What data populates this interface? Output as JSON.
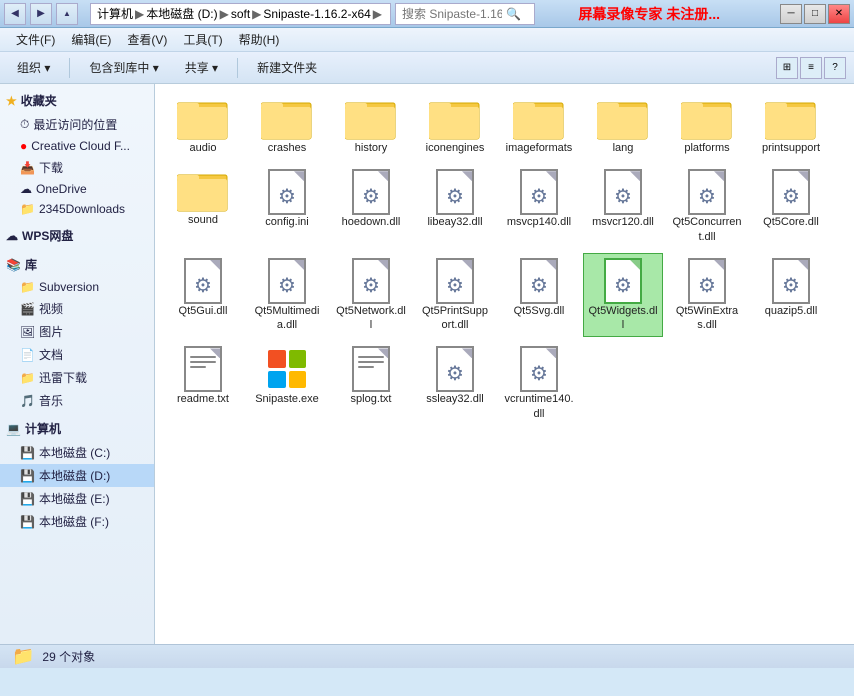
{
  "titleBar": {
    "pathParts": [
      "计算机",
      "本地磁盘 (D:)",
      "soft",
      "Snipaste-1.16.2-x64"
    ],
    "watermark": "屏幕录像专家 未注册...",
    "btns": [
      "min",
      "max",
      "close"
    ]
  },
  "menuBar": {
    "items": [
      "文件(F)",
      "编辑(E)",
      "查看(V)",
      "工具(T)",
      "帮助(H)"
    ]
  },
  "toolbar": {
    "organize": "组织 ▾",
    "include": "包含到库中 ▾",
    "share": "共享 ▾",
    "newFolder": "新建文件夹"
  },
  "sidebar": {
    "favorites": "收藏夹",
    "favoriteItems": [
      {
        "label": "最近访问的位置",
        "icon": "⏱"
      },
      {
        "label": "Creative Cloud F...",
        "icon": "🔴"
      },
      {
        "label": "下载",
        "icon": "📥"
      },
      {
        "label": "OneDrive",
        "icon": "☁"
      },
      {
        "label": "2345Downloads",
        "icon": "📁"
      }
    ],
    "wps": "WPS网盘",
    "library": "库",
    "libraryItems": [
      {
        "label": "Subversion",
        "icon": "📁"
      },
      {
        "label": "视频",
        "icon": "🎬"
      },
      {
        "label": "图片",
        "icon": "🖼"
      },
      {
        "label": "文档",
        "icon": "📄"
      },
      {
        "label": "迅雷下载",
        "icon": "📁"
      },
      {
        "label": "音乐",
        "icon": "🎵"
      }
    ],
    "computer": "计算机",
    "drives": [
      {
        "label": "本地磁盘 (C:)"
      },
      {
        "label": "本地磁盘 (D:)",
        "selected": true
      },
      {
        "label": "本地磁盘 (E:)"
      },
      {
        "label": "本地磁盘 (F:)"
      }
    ]
  },
  "files": {
    "folders": [
      {
        "name": "audio"
      },
      {
        "name": "crashes"
      },
      {
        "name": "history"
      },
      {
        "name": "iconengines"
      },
      {
        "name": "imageformats"
      },
      {
        "name": "lang"
      },
      {
        "name": "platforms"
      },
      {
        "name": "printsupport"
      },
      {
        "name": "sound"
      }
    ],
    "dlls": [
      {
        "name": "config.ini",
        "type": "ini"
      },
      {
        "name": "hoedown.dll",
        "type": "dll"
      },
      {
        "name": "libeay32.dll",
        "type": "dll"
      },
      {
        "name": "msvcp140.dll",
        "type": "dll"
      },
      {
        "name": "msvcr120.dll",
        "type": "dll"
      },
      {
        "name": "Qt5Concurrent.dll",
        "type": "dll"
      },
      {
        "name": "Qt5Core.dll",
        "type": "dll"
      },
      {
        "name": "Qt5Gui.dll",
        "type": "dll"
      },
      {
        "name": "Qt5Multimedia.dll",
        "type": "dll"
      },
      {
        "name": "Qt5Network.dll",
        "type": "dll"
      },
      {
        "name": "Qt5PrintSupport.dll",
        "type": "dll"
      },
      {
        "name": "Qt5Svg.dll",
        "type": "dll"
      },
      {
        "name": "Qt5Widgets.dll",
        "type": "dll",
        "selected": true
      },
      {
        "name": "Qt5WinExtras.dll",
        "type": "dll"
      },
      {
        "name": "quazip5.dll",
        "type": "dll"
      },
      {
        "name": "readme.txt",
        "type": "txt"
      },
      {
        "name": "Snipaste.exe",
        "type": "exe"
      },
      {
        "name": "splog.txt",
        "type": "txt"
      },
      {
        "name": "ssleay32.dll",
        "type": "dll"
      },
      {
        "name": "vcruntime140.dll",
        "type": "dll"
      }
    ]
  },
  "statusBar": {
    "count": "29 个对象"
  }
}
